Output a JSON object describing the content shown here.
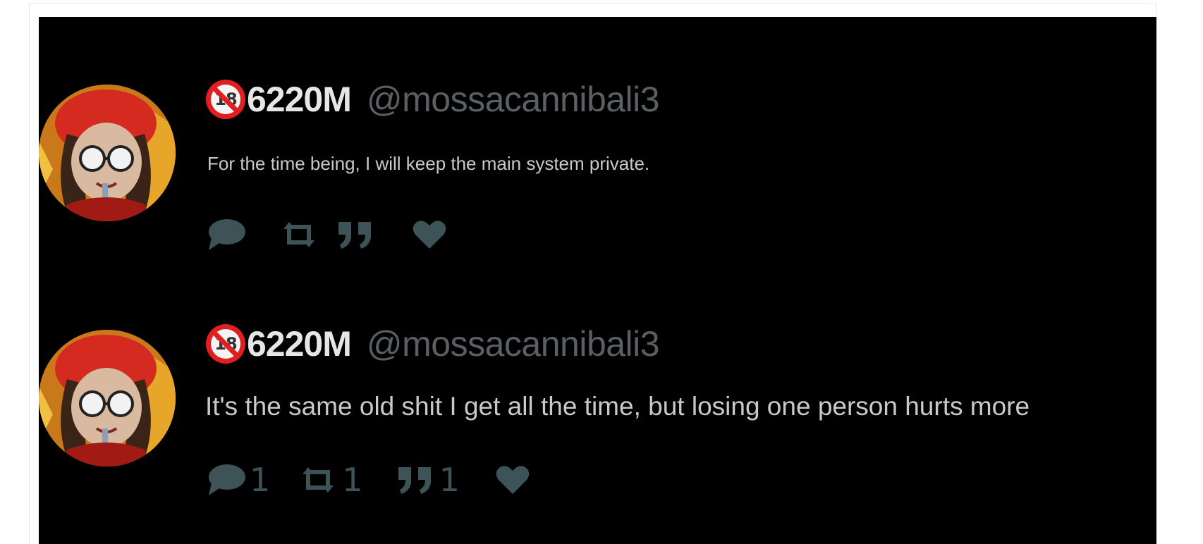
{
  "colors": {
    "background": "#000000",
    "display_name": "#e6e6e6",
    "handle": "#5a5f63",
    "tweet_text": "#c9c9c9",
    "action_icons": "#3e5358",
    "badge_red": "#e02020"
  },
  "tweets": [
    {
      "badge_text": "18",
      "display_name": "6220M",
      "handle": "@mossacannibali3",
      "text": "For the time being, I will keep the main system private.",
      "actions": [
        {
          "icon": "reply-icon",
          "count": ""
        },
        {
          "icon": "retweet-icon",
          "count": ""
        },
        {
          "icon": "quote-icon",
          "count": ""
        },
        {
          "icon": "heart-icon",
          "count": ""
        }
      ]
    },
    {
      "badge_text": "18",
      "display_name": "6220M",
      "handle": "@mossacannibali3",
      "text": "It's the same old shit I get all the time, but losing one person hurts more",
      "actions": [
        {
          "icon": "reply-icon",
          "count": "1"
        },
        {
          "icon": "retweet-icon",
          "count": "1"
        },
        {
          "icon": "quote-icon",
          "count": "1"
        },
        {
          "icon": "heart-icon",
          "count": ""
        }
      ]
    }
  ]
}
